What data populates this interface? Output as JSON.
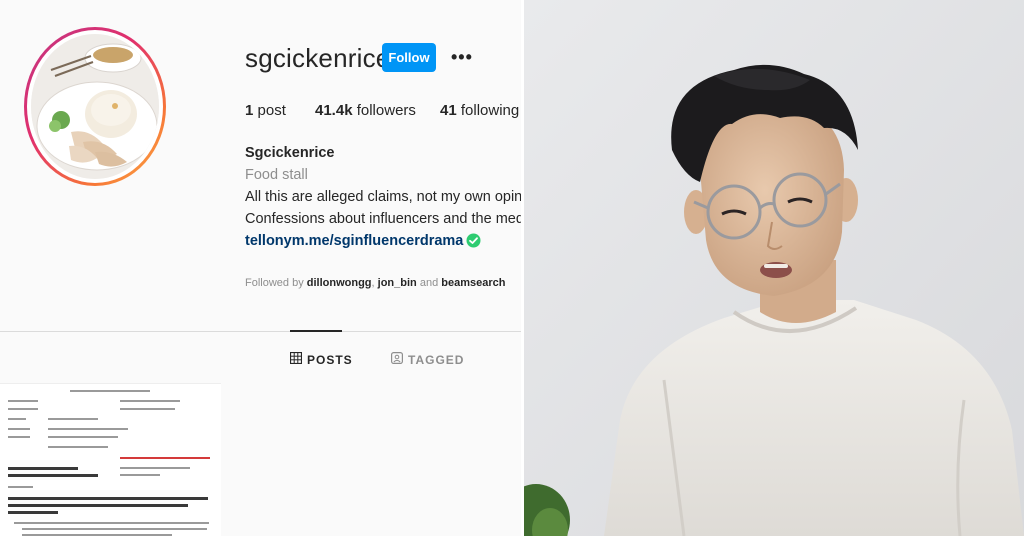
{
  "profile": {
    "username": "sgcickenrice",
    "follow_label": "Follow",
    "more_label": "•••",
    "stats": {
      "posts_count": "1",
      "posts_label": "post",
      "followers_count": "41.4k",
      "followers_label": "followers",
      "following_count": "41",
      "following_label": "following"
    },
    "bio": {
      "name": "Sgcickenrice",
      "category": "Food stall",
      "line1": "All this are alleged claims, not my own opinio",
      "line2": "Confessions about influencers and the media",
      "link": "tellonym.me/sginfluencerdrama"
    },
    "followed_by": {
      "prefix": "Followed by",
      "user1": "dillonwongg",
      "sep": ",",
      "user2": "jon_bin",
      "and": "and",
      "user3": "beamsearch"
    },
    "tabs": [
      {
        "label": "POSTS",
        "icon": "grid-icon"
      },
      {
        "label": "TAGGED",
        "icon": "tagged-icon"
      }
    ]
  },
  "colors": {
    "follow_button": "#0095f6",
    "link": "#00376b",
    "verified": "#2ecc71",
    "muted": "#8e8e8e",
    "ring_start": "#c13584",
    "ring_end": "#fcaf45"
  },
  "photo": {
    "subject": "young-man-with-round-glasses-white-sweatshirt"
  }
}
